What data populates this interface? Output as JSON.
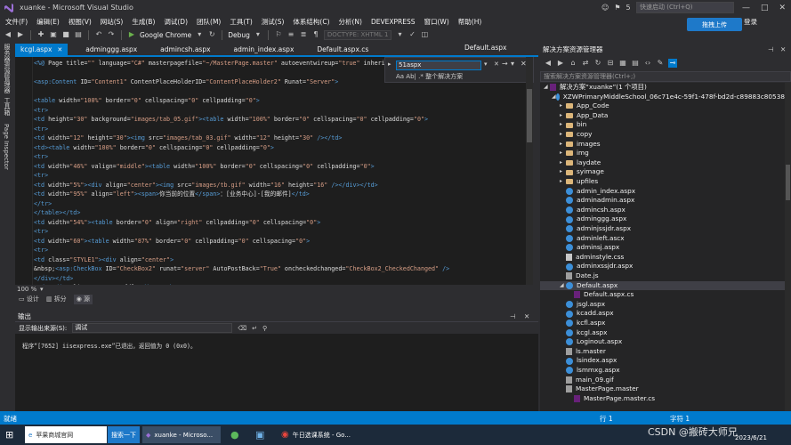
{
  "window": {
    "title": "xuanke - Microsoft Visual Studio",
    "notifications": "5",
    "quick_launch": "快速启动 (Ctrl+Q)",
    "controls": [
      "—",
      "□",
      "✕"
    ]
  },
  "menu": [
    "文件(F)",
    "编辑(E)",
    "视图(V)",
    "网站(S)",
    "生成(B)",
    "调试(D)",
    "团队(M)",
    "工具(T)",
    "测试(S)",
    "体系结构(C)",
    "分析(N)",
    "DEVEXPRESS",
    "窗口(W)",
    "帮助(H)"
  ],
  "account": {
    "login": "登录",
    "upload": "拖拽上传"
  },
  "toolbar": {
    "browser": "Google Chrome",
    "config": "Debug",
    "doctype": "DOCTYPE: XHTML 1"
  },
  "left_tabs": [
    "服务器资源管理器",
    "工具箱",
    "Page Inspector"
  ],
  "doc_tabs": [
    {
      "label": "kcgl.aspx",
      "active": true
    },
    {
      "label": "adminggg.aspx",
      "active": false
    },
    {
      "label": "admincsh.aspx",
      "active": false
    },
    {
      "label": "admin_index.aspx",
      "active": false
    },
    {
      "label": "Default.aspx.cs",
      "active": false
    }
  ],
  "doc_tab_right": "Default.aspx",
  "find": {
    "value": "51aspx",
    "options": "Aa  Ab|  .*   整个解决方案"
  },
  "code_lines": [
    "<%@ Page title=\"\" language=\"C#\" masterpagefile=\"~/MasterPage.master\" autoeventwireup=\"true\" inherits=\"",
    "",
    "<asp:Content ID=\"Content1\" ContentPlaceHolderID=\"ContentPlaceHolder2\" Runat=\"Server\">",
    "",
    "<table width=\"100%\" border=\"0\" cellspacing=\"0\" cellpadding=\"0\">",
    "  <tr>",
    "    <td height=\"30\" background=\"images/tab_05.gif\"><table width=\"100%\" border=\"0\" cellspacing=\"0\" cellpadding=\"0\">",
    "      <tr>",
    "        <td width=\"12\" height=\"30\"><img src=\"images/tab_03.gif\" width=\"12\" height=\"30\" /></td>",
    "        <td><table width=\"100%\" border=\"0\" cellspacing=\"0\" cellpadding=\"0\">",
    "          <tr>",
    "            <td width=\"46%\" valign=\"middle\"><table width=\"100%\" border=\"0\" cellspacing=\"0\" cellpadding=\"0\">",
    "              <tr>",
    "                <td width=\"5%\"><div align=\"center\"><img src=\"images/tb.gif\" width=\"16\" height=\"16\" /></div></td>",
    "                <td width=\"95%\" align=\"left\"><span>你当前的位置</span>：[业务中心]-[我的邮件]</td>",
    "              </tr>",
    "            </table></td>",
    "            <td width=\"54%\"><table border=\"0\" align=\"right\" cellpadding=\"0\" cellspacing=\"0\">",
    "              <tr>",
    "                <td width=\"60\"><table width=\"87%\" border=\"0\" cellpadding=\"0\" cellspacing=\"0\">",
    "                  <tr>",
    "                    <td class=\"STYLE1\"><div align=\"center\">",
    "                      &nbsp;<asp:CheckBox ID=\"CheckBox2\" runat=\"server\" AutoPostBack=\"True\" oncheckedchanged=\"CheckBox2_CheckedChanged\" />",
    "                    </div></td>",
    "                    <td ><div align=\"center\">全选</div></td>"
  ],
  "zoom": "100 %",
  "view_tabs": [
    "设计",
    "拆分",
    "源"
  ],
  "output": {
    "title": "输出",
    "source_label": "显示输出来源(S):",
    "source_value": "调试",
    "text": "程序“[7652] iisexpress.exe”已退出，返回值为 0 (0x0)。"
  },
  "solution_explorer": {
    "title": "解决方案资源管理器",
    "search": "搜索解决方案资源管理器(Ctrl+;)",
    "items": [
      {
        "label": "解决方案“xuanke”(1 个项目)",
        "kind": "sln",
        "depth": 0
      },
      {
        "label": "XZWPrimaryMiddleSchool_06c71e4c-59f1-478f-bd2d-c89883c80538",
        "kind": "web",
        "depth": 1
      },
      {
        "label": "App_Code",
        "kind": "folder",
        "depth": 2
      },
      {
        "label": "App_Data",
        "kind": "folder",
        "depth": 2
      },
      {
        "label": "bin",
        "kind": "folder",
        "depth": 2
      },
      {
        "label": "copy",
        "kind": "folder",
        "depth": 2
      },
      {
        "label": "images",
        "kind": "folder",
        "depth": 2
      },
      {
        "label": "img",
        "kind": "folder",
        "depth": 2
      },
      {
        "label": "laydate",
        "kind": "folder",
        "depth": 2
      },
      {
        "label": "syimage",
        "kind": "folder",
        "depth": 2
      },
      {
        "label": "upfiles",
        "kind": "folder",
        "depth": 2
      },
      {
        "label": "admin_index.aspx",
        "kind": "aspx",
        "depth": 2
      },
      {
        "label": "adminadmin.aspx",
        "kind": "aspx",
        "depth": 2
      },
      {
        "label": "admincsh.aspx",
        "kind": "aspx",
        "depth": 2
      },
      {
        "label": "adminggg.aspx",
        "kind": "aspx",
        "depth": 2
      },
      {
        "label": "adminjssjdr.aspx",
        "kind": "aspx",
        "depth": 2
      },
      {
        "label": "adminleft.ascx",
        "kind": "aspx",
        "depth": 2
      },
      {
        "label": "adminsj.aspx",
        "kind": "aspx",
        "depth": 2
      },
      {
        "label": "adminstyle.css",
        "kind": "css",
        "depth": 2
      },
      {
        "label": "adminxssjdr.aspx",
        "kind": "aspx",
        "depth": 2
      },
      {
        "label": "Date.js",
        "kind": "gen",
        "depth": 2
      },
      {
        "label": "Default.aspx",
        "kind": "aspx",
        "depth": 2,
        "selected": true
      },
      {
        "label": "Default.aspx.cs",
        "kind": "cs",
        "depth": 3
      },
      {
        "label": "jsgl.aspx",
        "kind": "aspx",
        "depth": 2
      },
      {
        "label": "kcadd.aspx",
        "kind": "aspx",
        "depth": 2
      },
      {
        "label": "kcfl.aspx",
        "kind": "aspx",
        "depth": 2
      },
      {
        "label": "kcgl.aspx",
        "kind": "aspx",
        "depth": 2
      },
      {
        "label": "Loginout.aspx",
        "kind": "aspx",
        "depth": 2
      },
      {
        "label": "ls.master",
        "kind": "gen",
        "depth": 2
      },
      {
        "label": "lsindex.aspx",
        "kind": "aspx",
        "depth": 2
      },
      {
        "label": "lsmmxg.aspx",
        "kind": "aspx",
        "depth": 2
      },
      {
        "label": "main_09.gif",
        "kind": "gen",
        "depth": 2
      },
      {
        "label": "MasterPage.master",
        "kind": "gen",
        "depth": 2
      },
      {
        "label": "MasterPage.master.cs",
        "kind": "cs",
        "depth": 3
      }
    ]
  },
  "status": {
    "left": "就绪",
    "line": "行 1",
    "col": "字符 1"
  },
  "taskbar": {
    "tasks": [
      "苹果商城官网",
      "搜索一下",
      "xuanke - Microso...",
      "",
      "",
      "午日选课系统 - Go..."
    ],
    "clock": "2023/6/21",
    "watermark": "CSDN @搬砖大师兄"
  },
  "colors": {
    "accent": "#007acc",
    "editor_bg": "#1e1e1e",
    "chrome_bg": "#2d2d30",
    "tag": "#569cd6",
    "attr": "#9cdcfe"
  }
}
